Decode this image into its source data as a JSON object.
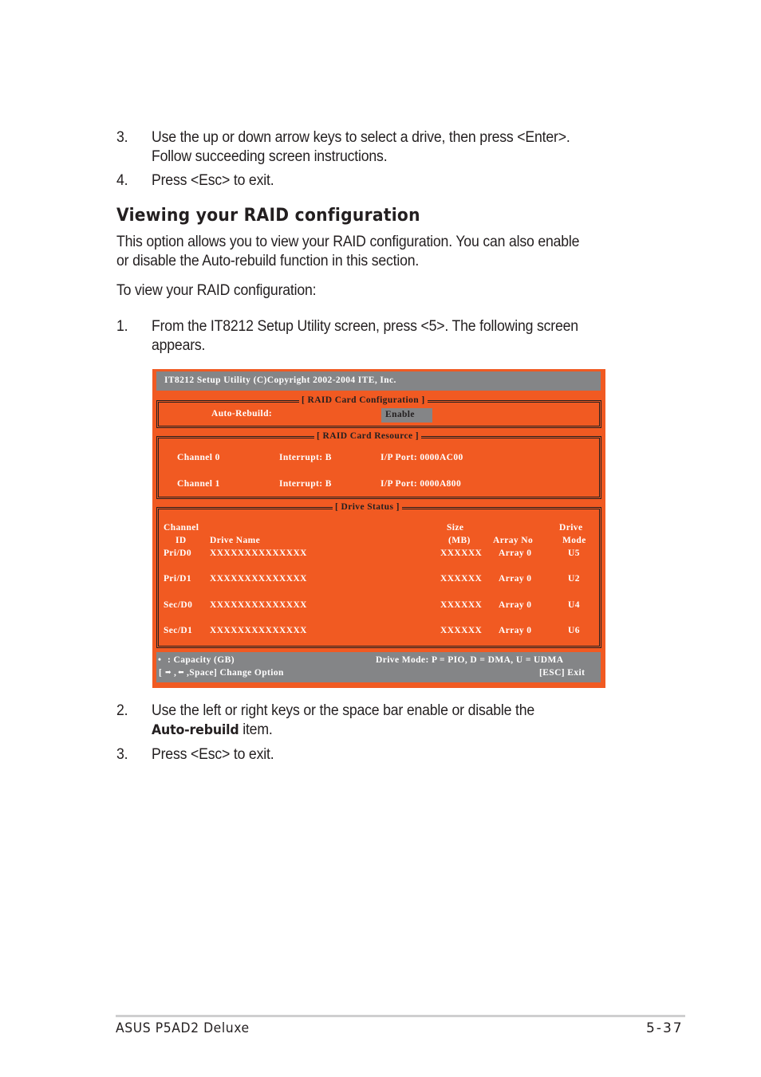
{
  "steps_top": [
    {
      "num": "3.",
      "line1": "Use the up or down arrow keys to select a drive, then press <Enter>.",
      "line2": "Follow succeeding screen instructions."
    },
    {
      "num": "4.",
      "line1": "Press <Esc> to exit."
    }
  ],
  "section": {
    "title": "Viewing your RAID configuration",
    "intro_line1": "This option allows you to view your RAID configuration. You can also enable",
    "intro_line2": "or disable the Auto-rebuild function in this section.",
    "to_view": "To view your RAID configuration:",
    "step1": {
      "num": "1.",
      "line1": "From the IT8212 Setup Utility screen, press <5>. The following screen",
      "line2": "appears."
    }
  },
  "bios": {
    "title": "IT8212 Setup Utility (C)Copyright 2002-2004 ITE, Inc.",
    "raid_config": {
      "label": "[ RAID Card Configuration ]",
      "auto_rebuild_label": "Auto-Rebuild:",
      "auto_rebuild_value": "Enable"
    },
    "resource": {
      "label": "[ RAID Card Resource ]",
      "channels": [
        {
          "name": "Channel 0",
          "interrupt": "Interrupt: B",
          "port": "I/P Port: 0000AC00"
        },
        {
          "name": "Channel 1",
          "interrupt": "Interrupt: B",
          "port": "I/P Port: 0000A800"
        }
      ]
    },
    "drive_status": {
      "label": "[ Drive Status ]",
      "headers": {
        "channel": "Channel",
        "id": "ID",
        "drive_name": "Drive Name",
        "size": "Size",
        "size_unit": "(MB)",
        "array_no": "Array No",
        "drive": "Drive",
        "mode": "Mode"
      },
      "rows": [
        {
          "id": "Pri/D0",
          "name": "XXXXXXXXXXXXXX",
          "size": "XXXXXX",
          "array": "Array 0",
          "mode": "U5"
        },
        {
          "id": "Pri/D1",
          "name": "XXXXXXXXXXXXXX",
          "size": "XXXXXX",
          "array": "Array 0",
          "mode": "U2"
        },
        {
          "id": "Sec/D0",
          "name": "XXXXXXXXXXXXXX",
          "size": "XXXXXX",
          "array": "Array 0",
          "mode": "U4"
        },
        {
          "id": "Sec/D1",
          "name": "XXXXXXXXXXXXXX",
          "size": "XXXXXX",
          "array": "Array 0",
          "mode": "U6"
        }
      ]
    },
    "footer": {
      "capacity": ": Capacity (GB)",
      "drive_mode_legend": "Drive Mode: P = PIO, D = DMA, U = UDMA",
      "keys_prefix": "[",
      "keys_suffix": ",Space] Change Option",
      "exit": "[ESC] Exit",
      "bullet_glyph": "•",
      "right_arrow": "➡",
      "left_arrow": "⬅"
    },
    "colors": {
      "background": "#f15a22",
      "bar": "#848587"
    }
  },
  "steps_bottom": [
    {
      "num": "2.",
      "line1": "Use the left or right keys or the space bar enable or disable the",
      "bold": "Auto-rebuild",
      "line2_rest": " item."
    },
    {
      "num": "3.",
      "line1": "Press <Esc> to exit."
    }
  ],
  "page_footer": {
    "manual": "ASUS P5AD2 Deluxe",
    "page": "5-37"
  }
}
